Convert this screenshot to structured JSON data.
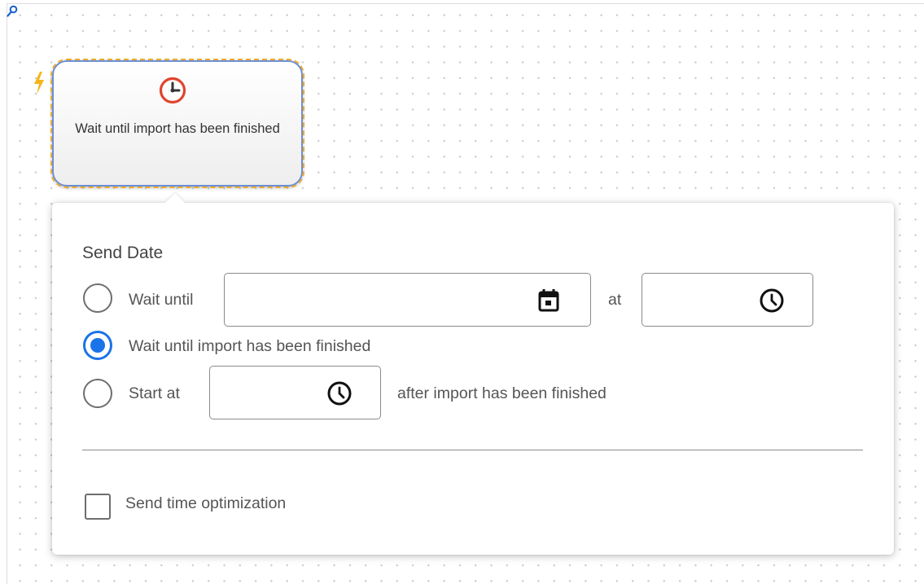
{
  "canvas": {
    "zoom_icon": "magnifier-icon",
    "trigger_icon": "lightning-bolt-icon"
  },
  "node": {
    "icon": "clock-icon",
    "label": "Wait until import has been finished",
    "colors": {
      "clock": "#e0442e",
      "outline_dashed": "#f0a92c",
      "border": "#6b8fd4"
    }
  },
  "popup": {
    "section_title": "Send Date",
    "options": [
      {
        "label": "Wait until",
        "selected": false,
        "date_value": "",
        "date_icon": "calendar-icon",
        "separator": "at",
        "time_value": "",
        "time_icon": "clock-icon"
      },
      {
        "label": "Wait until import has been finished",
        "selected": true
      },
      {
        "label": "Start at",
        "selected": false,
        "time_value": "",
        "time_icon": "clock-icon",
        "suffix": "after import has been finished"
      }
    ],
    "send_time_optimization": {
      "label": "Send time optimization",
      "checked": false
    },
    "colors": {
      "accent": "#1a73e8",
      "control_border": "#6e6e6e"
    }
  }
}
